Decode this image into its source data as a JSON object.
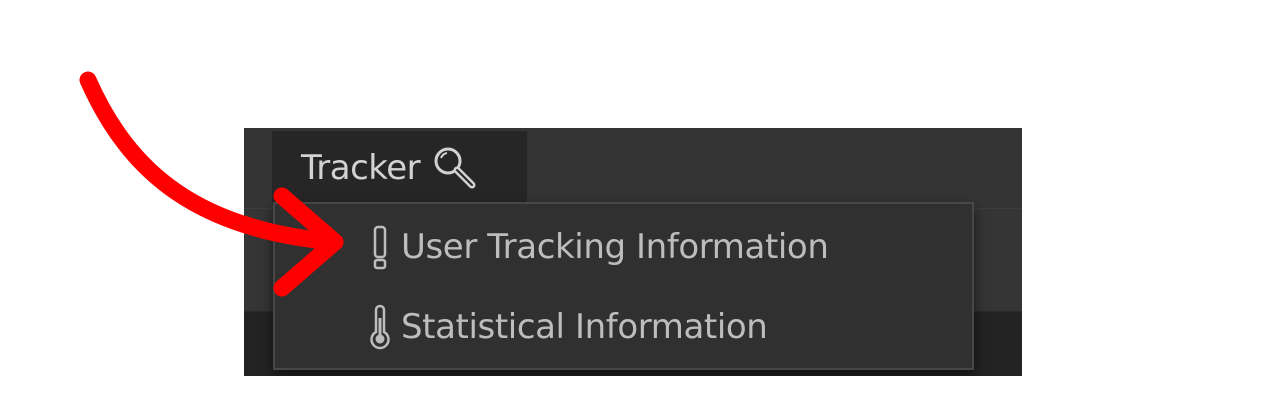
{
  "menu": {
    "title": "Tracker",
    "title_icon": "magnifier-icon",
    "items": [
      {
        "label": "User Tracking Information",
        "icon": "exclamation-icon"
      },
      {
        "label": "Statistical Information",
        "icon": "thermometer-icon"
      }
    ]
  },
  "annotation": {
    "arrow_color": "#ff0000",
    "type": "curved-arrow-pointing-to-menu-item"
  }
}
